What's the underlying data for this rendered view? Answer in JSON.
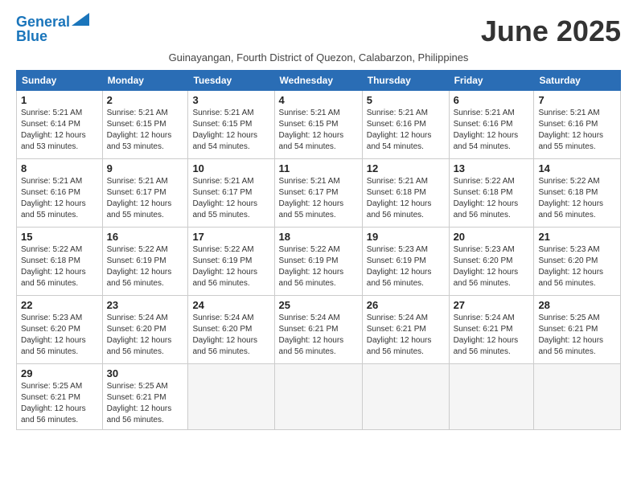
{
  "logo": {
    "line1": "General",
    "line2": "Blue"
  },
  "title": "June 2025",
  "subtitle": "Guinayangan, Fourth District of Quezon, Calabarzon, Philippines",
  "headers": [
    "Sunday",
    "Monday",
    "Tuesday",
    "Wednesday",
    "Thursday",
    "Friday",
    "Saturday"
  ],
  "weeks": [
    [
      {
        "day": "1",
        "rise": "5:21 AM",
        "set": "6:14 PM",
        "daylight": "12 hours and 53 minutes."
      },
      {
        "day": "2",
        "rise": "5:21 AM",
        "set": "6:15 PM",
        "daylight": "12 hours and 53 minutes."
      },
      {
        "day": "3",
        "rise": "5:21 AM",
        "set": "6:15 PM",
        "daylight": "12 hours and 54 minutes."
      },
      {
        "day": "4",
        "rise": "5:21 AM",
        "set": "6:15 PM",
        "daylight": "12 hours and 54 minutes."
      },
      {
        "day": "5",
        "rise": "5:21 AM",
        "set": "6:16 PM",
        "daylight": "12 hours and 54 minutes."
      },
      {
        "day": "6",
        "rise": "5:21 AM",
        "set": "6:16 PM",
        "daylight": "12 hours and 54 minutes."
      },
      {
        "day": "7",
        "rise": "5:21 AM",
        "set": "6:16 PM",
        "daylight": "12 hours and 55 minutes."
      }
    ],
    [
      {
        "day": "8",
        "rise": "5:21 AM",
        "set": "6:16 PM",
        "daylight": "12 hours and 55 minutes."
      },
      {
        "day": "9",
        "rise": "5:21 AM",
        "set": "6:17 PM",
        "daylight": "12 hours and 55 minutes."
      },
      {
        "day": "10",
        "rise": "5:21 AM",
        "set": "6:17 PM",
        "daylight": "12 hours and 55 minutes."
      },
      {
        "day": "11",
        "rise": "5:21 AM",
        "set": "6:17 PM",
        "daylight": "12 hours and 55 minutes."
      },
      {
        "day": "12",
        "rise": "5:21 AM",
        "set": "6:18 PM",
        "daylight": "12 hours and 56 minutes."
      },
      {
        "day": "13",
        "rise": "5:22 AM",
        "set": "6:18 PM",
        "daylight": "12 hours and 56 minutes."
      },
      {
        "day": "14",
        "rise": "5:22 AM",
        "set": "6:18 PM",
        "daylight": "12 hours and 56 minutes."
      }
    ],
    [
      {
        "day": "15",
        "rise": "5:22 AM",
        "set": "6:18 PM",
        "daylight": "12 hours and 56 minutes."
      },
      {
        "day": "16",
        "rise": "5:22 AM",
        "set": "6:19 PM",
        "daylight": "12 hours and 56 minutes."
      },
      {
        "day": "17",
        "rise": "5:22 AM",
        "set": "6:19 PM",
        "daylight": "12 hours and 56 minutes."
      },
      {
        "day": "18",
        "rise": "5:22 AM",
        "set": "6:19 PM",
        "daylight": "12 hours and 56 minutes."
      },
      {
        "day": "19",
        "rise": "5:23 AM",
        "set": "6:19 PM",
        "daylight": "12 hours and 56 minutes."
      },
      {
        "day": "20",
        "rise": "5:23 AM",
        "set": "6:20 PM",
        "daylight": "12 hours and 56 minutes."
      },
      {
        "day": "21",
        "rise": "5:23 AM",
        "set": "6:20 PM",
        "daylight": "12 hours and 56 minutes."
      }
    ],
    [
      {
        "day": "22",
        "rise": "5:23 AM",
        "set": "6:20 PM",
        "daylight": "12 hours and 56 minutes."
      },
      {
        "day": "23",
        "rise": "5:24 AM",
        "set": "6:20 PM",
        "daylight": "12 hours and 56 minutes."
      },
      {
        "day": "24",
        "rise": "5:24 AM",
        "set": "6:20 PM",
        "daylight": "12 hours and 56 minutes."
      },
      {
        "day": "25",
        "rise": "5:24 AM",
        "set": "6:21 PM",
        "daylight": "12 hours and 56 minutes."
      },
      {
        "day": "26",
        "rise": "5:24 AM",
        "set": "6:21 PM",
        "daylight": "12 hours and 56 minutes."
      },
      {
        "day": "27",
        "rise": "5:24 AM",
        "set": "6:21 PM",
        "daylight": "12 hours and 56 minutes."
      },
      {
        "day": "28",
        "rise": "5:25 AM",
        "set": "6:21 PM",
        "daylight": "12 hours and 56 minutes."
      }
    ],
    [
      {
        "day": "29",
        "rise": "5:25 AM",
        "set": "6:21 PM",
        "daylight": "12 hours and 56 minutes."
      },
      {
        "day": "30",
        "rise": "5:25 AM",
        "set": "6:21 PM",
        "daylight": "12 hours and 56 minutes."
      },
      null,
      null,
      null,
      null,
      null
    ]
  ]
}
